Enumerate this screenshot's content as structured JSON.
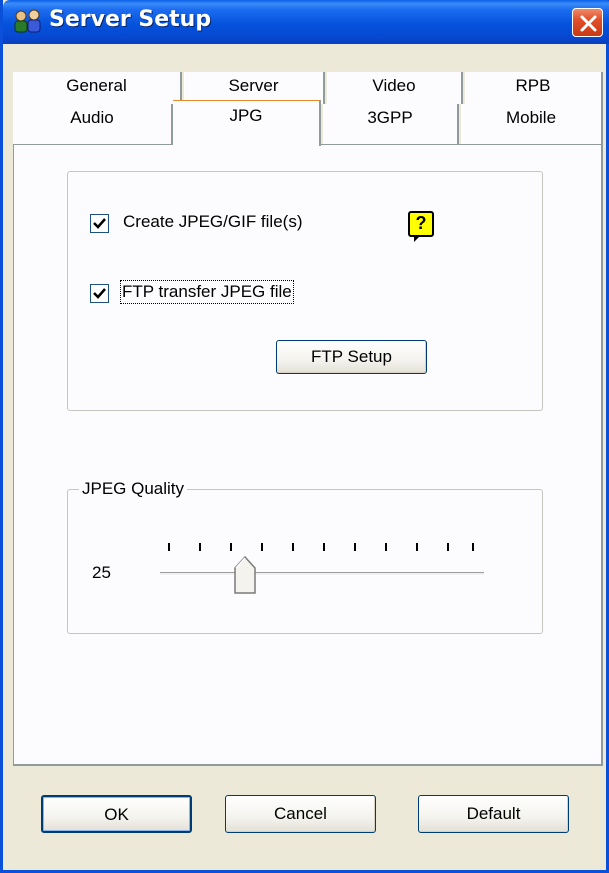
{
  "window": {
    "title": "Server Setup"
  },
  "tabs": {
    "row1": [
      "General",
      "Server",
      "Video",
      "RPB"
    ],
    "row2": [
      "Audio",
      "JPG",
      "3GPP",
      "Mobile"
    ],
    "active": "JPG"
  },
  "jpg": {
    "create_file": {
      "label": "Create JPEG/GIF file(s)",
      "checked": true
    },
    "help_symbol": "?",
    "ftp_transfer": {
      "label": "FTP transfer JPEG file",
      "checked": true
    },
    "ftp_setup_label": "FTP Setup",
    "quality": {
      "legend": "JPEG Quality",
      "value": "25",
      "slider_min": 0,
      "slider_max": 100,
      "slider_value": 25,
      "tick_count": 11
    }
  },
  "footer": {
    "ok": "OK",
    "cancel": "Cancel",
    "default": "Default"
  },
  "colors": {
    "titlebar": "#0552dc",
    "close": "#e0502a",
    "face": "#ece9d8",
    "panel": "#fcfcfe",
    "help": "#ffff00"
  }
}
